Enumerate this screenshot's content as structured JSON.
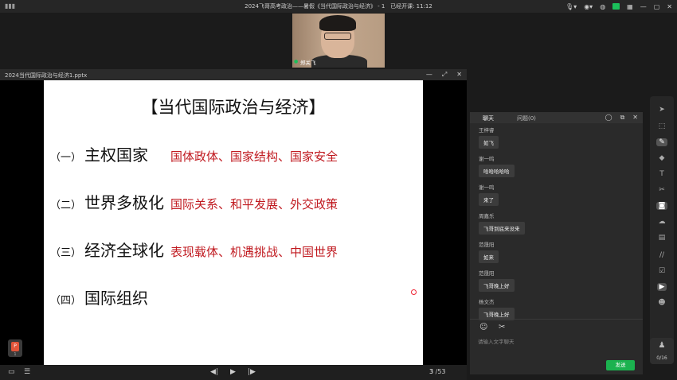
{
  "topbar": {
    "title": "2024飞哥高考政治——暑假《当代国际政治与经济》 - 1",
    "elapsed": "已经开课: 11:12",
    "signal_icon": "signal-icon",
    "mic_icon": "mic-icon",
    "camera_icon": "camera-icon",
    "accent": "#1bbf5a"
  },
  "presenter": {
    "name": "郑关飞"
  },
  "presentation": {
    "file_name": "2024当代国际政治与经济1.pptx",
    "slide": {
      "title": "【当代国际政治与经济】",
      "rows": [
        {
          "num": "（一）",
          "main": "主权国家",
          "sub": "国体政体、国家结构、国家安全"
        },
        {
          "num": "（二）",
          "main": "世界多极化",
          "sub": "国际关系、和平发展、外交政策"
        },
        {
          "num": "（三）",
          "main": "经济全球化",
          "sub": "表现载体、机遇挑战、中国世界"
        },
        {
          "num": "（四）",
          "main": "国际组织",
          "sub": ""
        }
      ]
    },
    "thumb_count": "1",
    "page_current": "3",
    "page_total": "/53"
  },
  "chat": {
    "tab_chat": "聊天",
    "tab_questions": "问题(0)",
    "messages": [
      {
        "who": "王梓睿",
        "text": "如飞"
      },
      {
        "who": "谢一鸣",
        "text": "哈哈哈哈哈"
      },
      {
        "who": "谢一鸣",
        "text": "来了"
      },
      {
        "who": "周嘉乐",
        "text": "飞哥到底来没来"
      },
      {
        "who": "范晟阳",
        "text": "如来"
      },
      {
        "who": "范晟阳",
        "text": "飞哥晚上好"
      },
      {
        "who": "杨文杰",
        "text": "飞哥晚上好"
      }
    ],
    "input_placeholder": "请输入文字聊天",
    "send_label": "发送"
  },
  "toolbar": {
    "page_count": "0/16"
  }
}
